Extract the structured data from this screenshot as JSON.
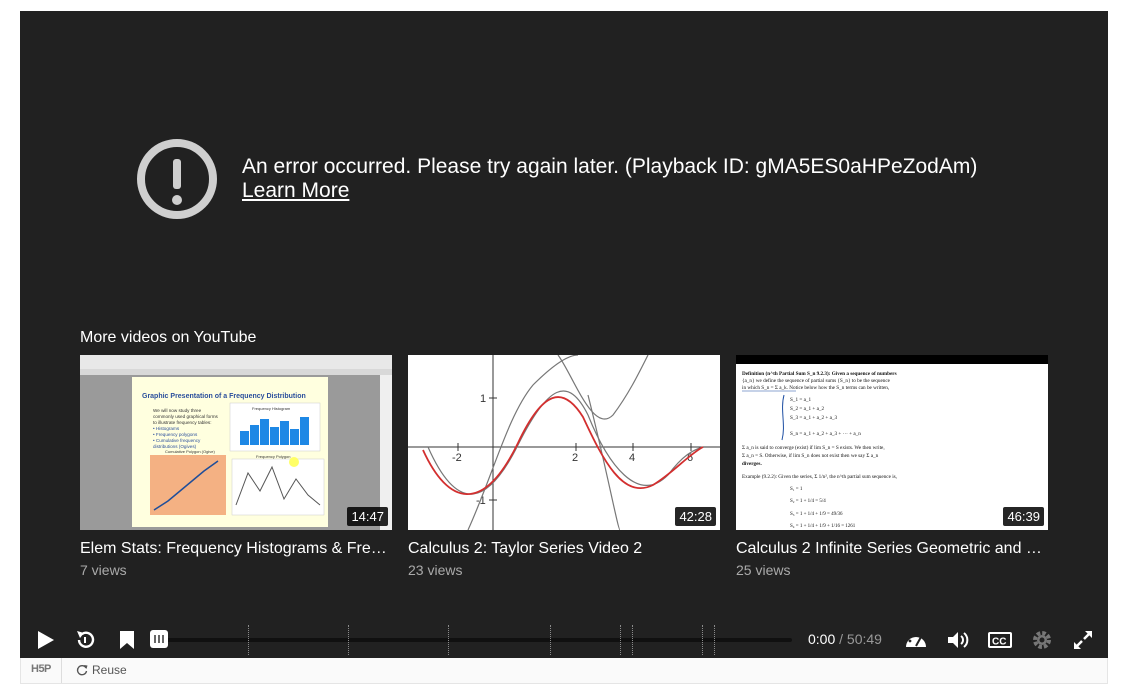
{
  "error": {
    "message": "An error occurred. Please try again later. (Playback ID: gMA5ES0aHPeZodAm)",
    "link": "Learn More"
  },
  "more_videos": {
    "title": "More videos on YouTube",
    "videos": [
      {
        "title": "Elem Stats: Frequency Histograms & Freq...",
        "views": "7 views",
        "duration": "14:47",
        "thumb_heading": "Graphic Presentation of a Frequency Distribution",
        "thumb_lines": [
          "We will now study three",
          "commonly used graphical forms",
          "to illustrate frequency tables:",
          "• Histograms",
          "• Frequency polygons",
          "• Cumulative frequency",
          "  distributions (Ogives)"
        ],
        "thumb_chart1": "Frequency Histogram",
        "thumb_chart2": "Cumulative Polygon (Ogive)",
        "thumb_chart3": "Frequency Polygon"
      },
      {
        "title": "Calculus 2: Taylor Series Video 2",
        "views": "23 views",
        "duration": "42:28",
        "thumb_labels": [
          "-2",
          "2",
          "4",
          "6",
          "1",
          "-1"
        ]
      },
      {
        "title": "Calculus 2 Infinite Series Geometric and C...",
        "views": "25 views",
        "duration": "46:39",
        "thumb_lines": [
          "Definition (n^th Partial Sum S_n 9.2.3): Given a sequence of numbers",
          "{a_n} we define the sequence of partial sums {S_n} to be the sequence",
          "in which S_n = Σ a_k. Notice below how the S_n terms can be written,",
          "S_1 = a_1",
          "S_2 = a_1 + a_2",
          "S_3 = a_1 + a_2 + a_3",
          "S_n = a_1 + a_2 + a_3 + ··· + a_n",
          "Σ a_n is said to converge (exist) if lim S_n = S exists. We then write,",
          "Σ a_n = S. Otherwise, if lim S_n does not exist then we say Σ a_n",
          "diverges.",
          "Example (9.2.2): Given the series, Σ 1/n², the n^th partial sum sequence is,"
        ]
      }
    ]
  },
  "controls": {
    "current_time": "0:00",
    "separator": " / ",
    "duration": "50:49",
    "progress": 0,
    "icons": [
      "play-icon",
      "replay-icon",
      "bookmark-icon",
      "speed-icon",
      "volume-icon",
      "captions-icon",
      "settings-icon",
      "fullscreen-icon"
    ]
  },
  "footer": {
    "logo": "H5P",
    "reuse_label": "Reuse"
  }
}
